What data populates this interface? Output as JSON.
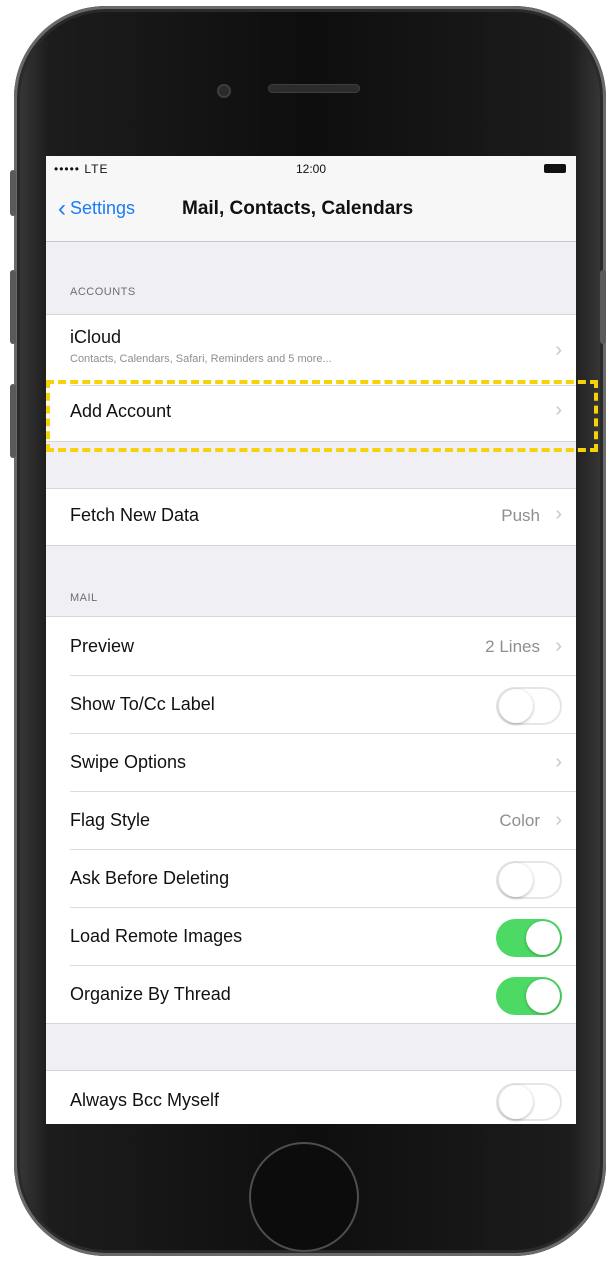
{
  "status_bar": {
    "carrier": "••••• LTE",
    "time": "12:00"
  },
  "navbar": {
    "back_label": "Settings",
    "title": "Mail, Contacts, Calendars"
  },
  "accounts": {
    "header": "ACCOUNTS",
    "icloud": {
      "label": "iCloud",
      "subtitle": "Contacts, Calendars, Safari, Reminders and 5 more..."
    },
    "add_account": {
      "label": "Add Account"
    }
  },
  "fetch": {
    "label": "Fetch New Data",
    "value": "Push"
  },
  "mail": {
    "header": "MAIL",
    "rows": [
      {
        "label": "Preview",
        "value": "2 Lines",
        "type": "value"
      },
      {
        "label": "Show To/Cc Label",
        "type": "toggle",
        "on": false
      },
      {
        "label": "Swipe Options",
        "type": "chevron"
      },
      {
        "label": "Flag Style",
        "value": "Color",
        "type": "value"
      },
      {
        "label": "Ask Before Deleting",
        "type": "toggle",
        "on": false
      },
      {
        "label": "Load Remote Images",
        "type": "toggle",
        "on": true
      },
      {
        "label": "Organize By Thread",
        "type": "toggle",
        "on": true
      }
    ]
  },
  "bcc": {
    "label": "Always Bcc Myself",
    "on": false
  },
  "colors": {
    "accent": "#1a7cf6",
    "toggle_on": "#4cd964",
    "highlight": "#f5d20a"
  },
  "icons": {
    "back": "chevron-left-icon",
    "chevron": "chevron-right-icon"
  }
}
